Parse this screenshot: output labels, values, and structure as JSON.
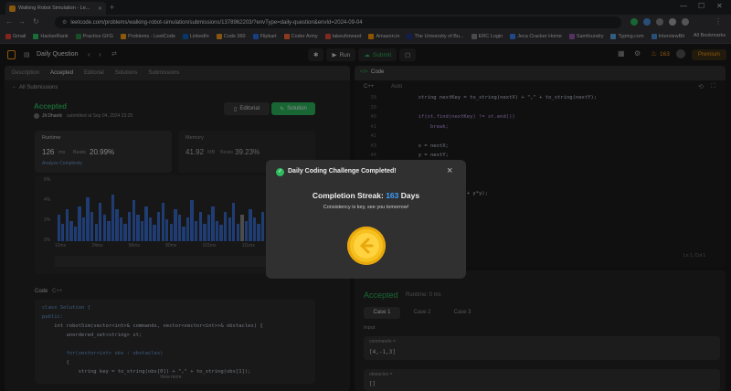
{
  "browser": {
    "tab_title": "Walking Robot Simulation - Le...",
    "url": "leetcode.com/problems/walking-robot-simulation/submissions/1378962203/?envType=daily-question&envId=2024-09-04",
    "bookmarks": [
      "Gmail",
      "HackerRank",
      "Practice GFG",
      "Problems - LeetCode",
      "LinkedIn",
      "Code 360",
      "Flipkart",
      "Coder Army",
      "takeuforward",
      "Amazon.in",
      "The University of Bu...",
      "ERC Login",
      "Jeca Cracker Home",
      "Samfoundry",
      "Typing.com",
      "InterviewBit"
    ],
    "all_bookmarks": "All Bookmarks",
    "bookmark_colors": [
      "#ea4335",
      "#2ec866",
      "#2f8d46",
      "#ffa116",
      "#0a66c2",
      "#f79b1e",
      "#2874f0",
      "#ff6b35",
      "#e74c3c",
      "#ff9900",
      "#1f3a93",
      "#888888",
      "#3b82f6",
      "#9b59b6",
      "#5aa9e6",
      "#4a90d9"
    ]
  },
  "header": {
    "daily_question": "Daily Question",
    "run": "Run",
    "submit": "Submit",
    "streak_count": "163",
    "premium": "Premium"
  },
  "left_panel": {
    "tabs": [
      "Description",
      "Accepted",
      "Editorial",
      "Solutions",
      "Submissions"
    ],
    "back_link": "All Submissions",
    "status": "Accepted",
    "author": "Jit Dhanik",
    "submitted_at": "submitted at Sep 04, 2024 23:25",
    "editorial_btn": "Editorial",
    "solution_btn": "Solution",
    "runtime_label": "Runtime",
    "runtime_value": "126",
    "runtime_unit": "ms",
    "runtime_beats_label": "Beats",
    "runtime_beats": "20.99%",
    "analyze": "Analyze Complexity",
    "memory_label": "Memory",
    "memory_value": "41.92",
    "memory_unit": "MB",
    "memory_beats_label": "Beats",
    "memory_beats": "39.23%",
    "y_ticks": [
      "6%",
      "4%",
      "2%",
      "0%"
    ],
    "x_ticks": [
      "12ms",
      "24ms",
      "56ms",
      "80ms",
      "101ms",
      "111ms",
      "122ms"
    ],
    "code_tab": "Code",
    "code_lang": "C++",
    "view_more": "View more",
    "code_lines": [
      "class Solution {",
      "public:",
      "    int robotSim(vector<int>& commands, vector<vector<int>>& obstacles) {",
      "        unordered_set<string> st;",
      "",
      "        for(vector<int> obs : obstacles)",
      "        {",
      "            string key = to_string(obs[0]) + \",\" + to_string(obs[1]);"
    ],
    "bar_heights": [
      0.45,
      0.3,
      0.55,
      0.35,
      0.25,
      0.6,
      0.4,
      0.75,
      0.5,
      0.3,
      0.65,
      0.45,
      0.35,
      0.8,
      0.55,
      0.4,
      0.3,
      0.5,
      0.7,
      0.45,
      0.35,
      0.6,
      0.4,
      0.28,
      0.5,
      0.65,
      0.38,
      0.3,
      0.55,
      0.45,
      0.25,
      0.4,
      0.7,
      0.35,
      0.5,
      0.3,
      0.45,
      0.6,
      0.35,
      0.28,
      0.5,
      0.4,
      0.65,
      0.3,
      0.45,
      0.35,
      0.55,
      0.4,
      0.3,
      0.5,
      0.2,
      0.35,
      0.25,
      0.45,
      0.3,
      0.2,
      0.35
    ]
  },
  "right_panel": {
    "title": "Code",
    "lang": "C++",
    "auto": "Auto",
    "line_numbers": [
      "38",
      "39",
      "40",
      "41",
      "42",
      "43",
      "44",
      "45",
      "46",
      "47",
      "48"
    ],
    "code_lines": [
      "            string nextKey = to_string(nextX) + \",\" + to_string(nextY);",
      "",
      "            if(st.find(nextKey) != st.end())",
      "                break;",
      "",
      "            x = nextX;",
      "            y = nextY;",
      "        }",
      "    }",
      "",
      "    return maxDistance, x*x + y*y);"
    ],
    "cursor_pos": "Ln 1, Col 1",
    "result_status": "Accepted",
    "result_runtime": "Runtime: 0 ms",
    "cases": [
      "Case 1",
      "Case 2",
      "Case 3"
    ],
    "input_label": "Input",
    "commands_label": "commands =",
    "commands_value": "[4,-1,3]",
    "obstacles_label": "obstacles =",
    "obstacles_value": "[]"
  },
  "modal": {
    "title": "Daily Coding Challenge Completed!",
    "streak_label": "Completion Streak:",
    "streak_num": "163",
    "streak_unit": "Days",
    "message": "Consistency is key, see you tomorrow!"
  }
}
